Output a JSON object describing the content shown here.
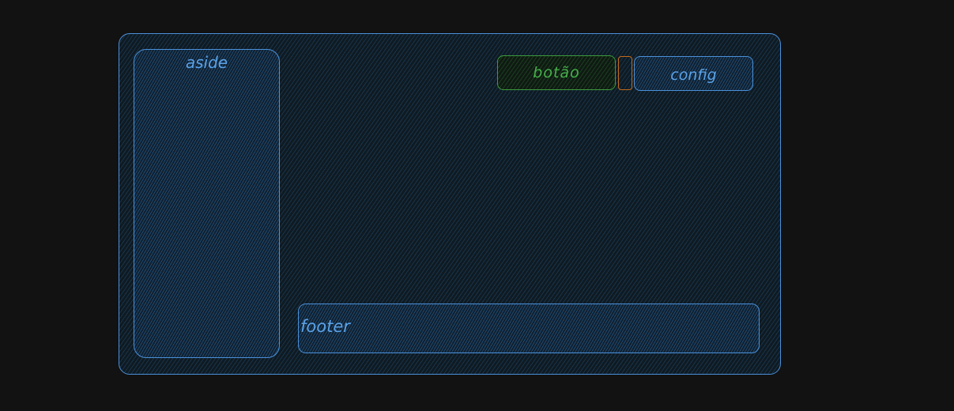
{
  "diagram": {
    "aside": {
      "label": "aside"
    },
    "button_primary": {
      "label": "botão"
    },
    "button_config": {
      "label": "config"
    },
    "footer": {
      "label": "footer"
    }
  },
  "colors": {
    "background": "#121212",
    "blue_stroke": "#4a90d9",
    "blue_text": "#5aa2e8",
    "green_stroke": "#3d9a3d",
    "green_text": "#46b04a",
    "orange_stroke": "#c46a1a"
  }
}
